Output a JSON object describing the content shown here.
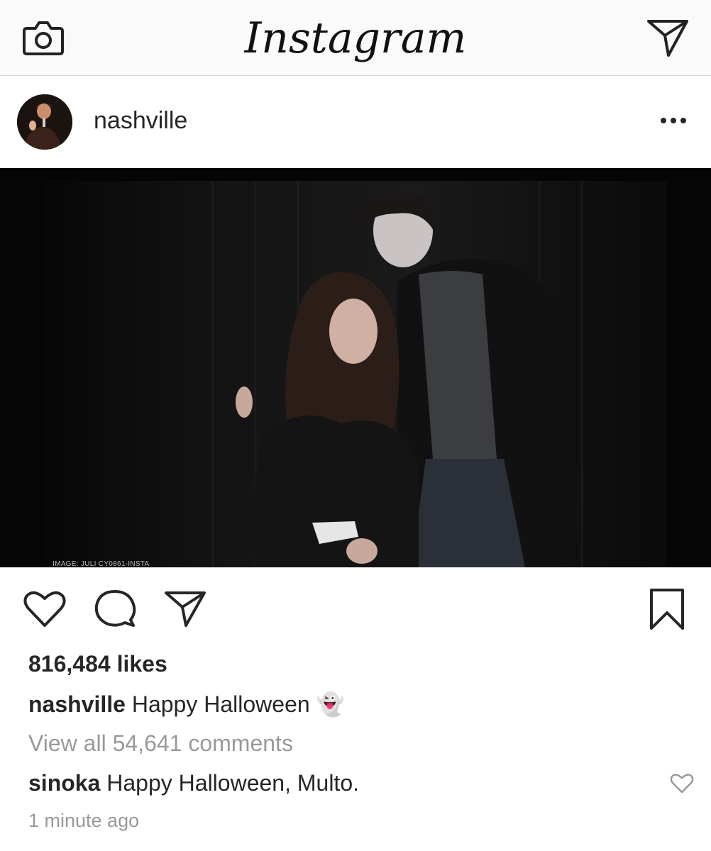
{
  "topbar": {
    "logo": "Instagram",
    "camera_icon": "camera-icon",
    "direct_icon": "paper-plane-icon"
  },
  "post": {
    "username": "nashville",
    "more_icon": "more-dots-icon",
    "image_watermark": "IMAGE: JULI CY0861-INSTA",
    "likes": "816,484 likes",
    "caption": {
      "username": "nashville",
      "text": "Happy Halloween",
      "emoji": "👻"
    },
    "view_all_comments": "View all 54,641 comments",
    "comments": [
      {
        "username": "sinoka",
        "text": "Happy Halloween, Multo."
      }
    ],
    "timestamp": "1 minute ago"
  },
  "colors": {
    "text": "#262626",
    "muted": "#999999",
    "topbar_bg": "#fafafa",
    "photo_bg": "#050505"
  }
}
